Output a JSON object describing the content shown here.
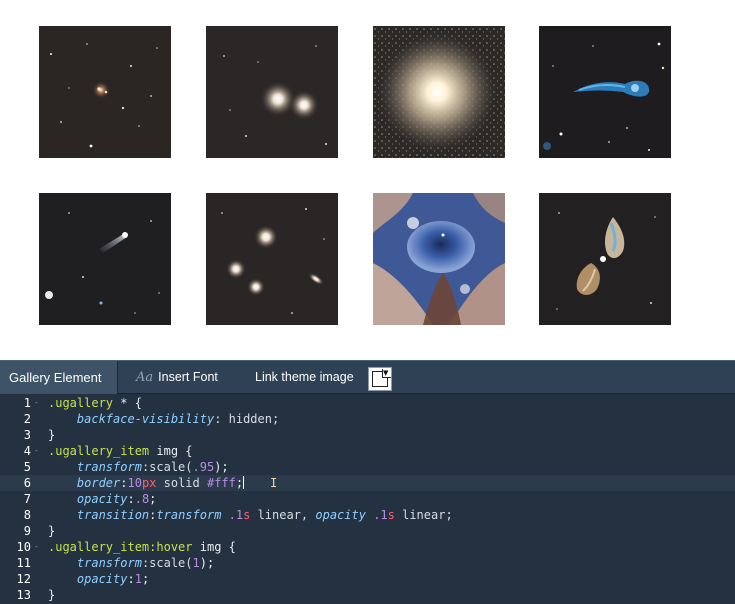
{
  "gallery": {
    "items": [
      {
        "id": "galaxy-sparse-field"
      },
      {
        "id": "twin-galaxies"
      },
      {
        "id": "globular-cluster"
      },
      {
        "id": "blue-tadpole-galaxy"
      },
      {
        "id": "comet-galaxy"
      },
      {
        "id": "galaxy-group"
      },
      {
        "id": "nebula-clouds"
      },
      {
        "id": "bipolar-nebula"
      }
    ]
  },
  "toolbar": {
    "active_tab": "Gallery Element",
    "insert_font_prefix": "Aa",
    "insert_font": "Insert Font",
    "link_theme_image": "Link theme image"
  },
  "editor": {
    "lines": [
      {
        "n": "1",
        "fold": "-",
        "tokens": [
          [
            ".ugallery",
            "sel"
          ],
          [
            " * {",
            "pun"
          ]
        ]
      },
      {
        "n": "2",
        "fold": "",
        "tokens": [
          [
            "    ",
            "pun"
          ],
          [
            "backface-visibility",
            "prop"
          ],
          [
            ": hidden;",
            "val"
          ]
        ]
      },
      {
        "n": "3",
        "fold": "",
        "tokens": [
          [
            "}",
            "pun"
          ]
        ]
      },
      {
        "n": "4",
        "fold": "-",
        "tokens": [
          [
            ".ugallery_item",
            "sel"
          ],
          [
            " img {",
            "pun"
          ]
        ]
      },
      {
        "n": "5",
        "fold": "",
        "tokens": [
          [
            "    ",
            "pun"
          ],
          [
            "transform",
            "prop"
          ],
          [
            ":scale(",
            "fn"
          ],
          [
            ".95",
            "num"
          ],
          [
            ");",
            "pun"
          ]
        ]
      },
      {
        "n": "6",
        "fold": "",
        "tokens": [
          [
            "    ",
            "pun"
          ],
          [
            "border",
            "prop"
          ],
          [
            ":",
            "pun"
          ],
          [
            "10",
            "num"
          ],
          [
            "px",
            "unit"
          ],
          [
            " solid ",
            "val"
          ],
          [
            "#fff",
            "hash"
          ],
          [
            ";",
            "pun"
          ]
        ]
      },
      {
        "n": "7",
        "fold": "",
        "tokens": [
          [
            "    ",
            "pun"
          ],
          [
            "opacity",
            "prop"
          ],
          [
            ":",
            "pun"
          ],
          [
            ".8",
            "num"
          ],
          [
            ";",
            "pun"
          ]
        ]
      },
      {
        "n": "8",
        "fold": "",
        "tokens": [
          [
            "    ",
            "pun"
          ],
          [
            "transition",
            "prop"
          ],
          [
            ":",
            "pun"
          ],
          [
            "transform",
            "prop"
          ],
          [
            " ",
            "pun"
          ],
          [
            ".1",
            "num"
          ],
          [
            "s",
            "unit"
          ],
          [
            " linear, ",
            "val"
          ],
          [
            "opacity",
            "prop"
          ],
          [
            " ",
            "pun"
          ],
          [
            ".1",
            "num"
          ],
          [
            "s",
            "unit"
          ],
          [
            " linear;",
            "val"
          ]
        ]
      },
      {
        "n": "9",
        "fold": "",
        "tokens": [
          [
            "}",
            "pun"
          ]
        ]
      },
      {
        "n": "10",
        "fold": "-",
        "tokens": [
          [
            ".ugallery_item",
            "sel"
          ],
          [
            ":hover",
            "sel"
          ],
          [
            " img {",
            "pun"
          ]
        ]
      },
      {
        "n": "11",
        "fold": "",
        "tokens": [
          [
            "    ",
            "pun"
          ],
          [
            "transform",
            "prop"
          ],
          [
            ":scale(",
            "fn"
          ],
          [
            "1",
            "num"
          ],
          [
            ");",
            "pun"
          ]
        ]
      },
      {
        "n": "12",
        "fold": "",
        "tokens": [
          [
            "    ",
            "pun"
          ],
          [
            "opacity",
            "prop"
          ],
          [
            ":",
            "pun"
          ],
          [
            "1",
            "num"
          ],
          [
            ";",
            "pun"
          ]
        ]
      },
      {
        "n": "13",
        "fold": "",
        "tokens": [
          [
            "}",
            "pun"
          ]
        ]
      }
    ],
    "active_line": "6"
  },
  "colors": {
    "editor_bg": "#233140",
    "toolbar_bg": "#2f4255",
    "selector": "#c6e34b",
    "property": "#8fd0ff",
    "number": "#b88ce6",
    "unit": "#ff5f6b"
  }
}
